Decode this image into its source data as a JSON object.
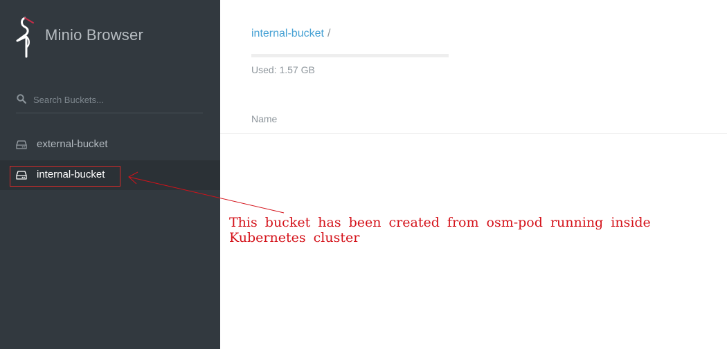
{
  "app": {
    "title": "Minio Browser"
  },
  "search": {
    "placeholder": "Search Buckets..."
  },
  "buckets": [
    {
      "name": "external-bucket"
    },
    {
      "name": "internal-bucket"
    }
  ],
  "breadcrumb": {
    "bucket": "internal-bucket",
    "separator": "/"
  },
  "usage": {
    "text": "Used: 1.57 GB"
  },
  "table": {
    "columns": [
      "Name"
    ]
  },
  "annotation": {
    "text": "This bucket has been created from osm-pod running inside Kubernetes cluster",
    "color": "#d4121a"
  },
  "colors": {
    "sidebar_bg": "#32393f",
    "active_item_bg": "#2b3136",
    "link": "#46a1d4",
    "logo_accent": "#c72c48"
  }
}
